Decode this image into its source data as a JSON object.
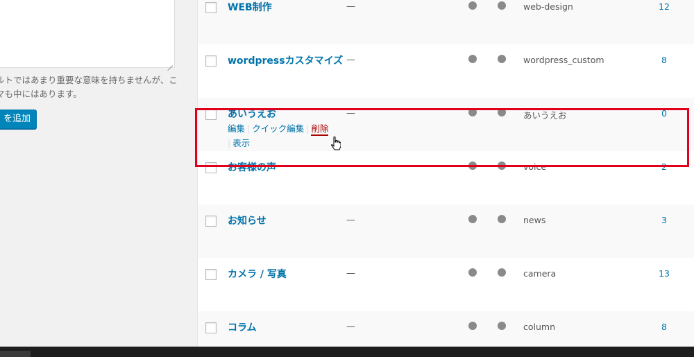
{
  "left": {
    "description_line1": "ルトではあまり重要な意味を持ちませんが、こ",
    "description_line2": "マも中にはあります。",
    "add_button_label": "を追加"
  },
  "rows": [
    {
      "name": "WEB制作",
      "description": "—",
      "slug": "web-design",
      "count": "12"
    },
    {
      "name": "wordpressカスタマイズ",
      "description": "—",
      "slug": "wordpress_custom",
      "count": "8"
    },
    {
      "name": "あいうえお",
      "description": "—",
      "slug": "あいうえお",
      "count": "0",
      "actions": {
        "edit": "編集",
        "quick_edit": "クイック編集",
        "delete": "削除",
        "view": "表示"
      }
    },
    {
      "name": "お客様の声",
      "description": "—",
      "slug": "voice",
      "count": "2"
    },
    {
      "name": "お知らせ",
      "description": "—",
      "slug": "news",
      "count": "3"
    },
    {
      "name": "カメラ / 写真",
      "description": "—",
      "slug": "camera",
      "count": "13"
    },
    {
      "name": "コラム",
      "description": "—",
      "slug": "column",
      "count": "8"
    }
  ],
  "colors": {
    "link": "#0073aa",
    "delete": "#aa0000",
    "highlight_border": "#e0001b",
    "button": "#0085ba"
  }
}
